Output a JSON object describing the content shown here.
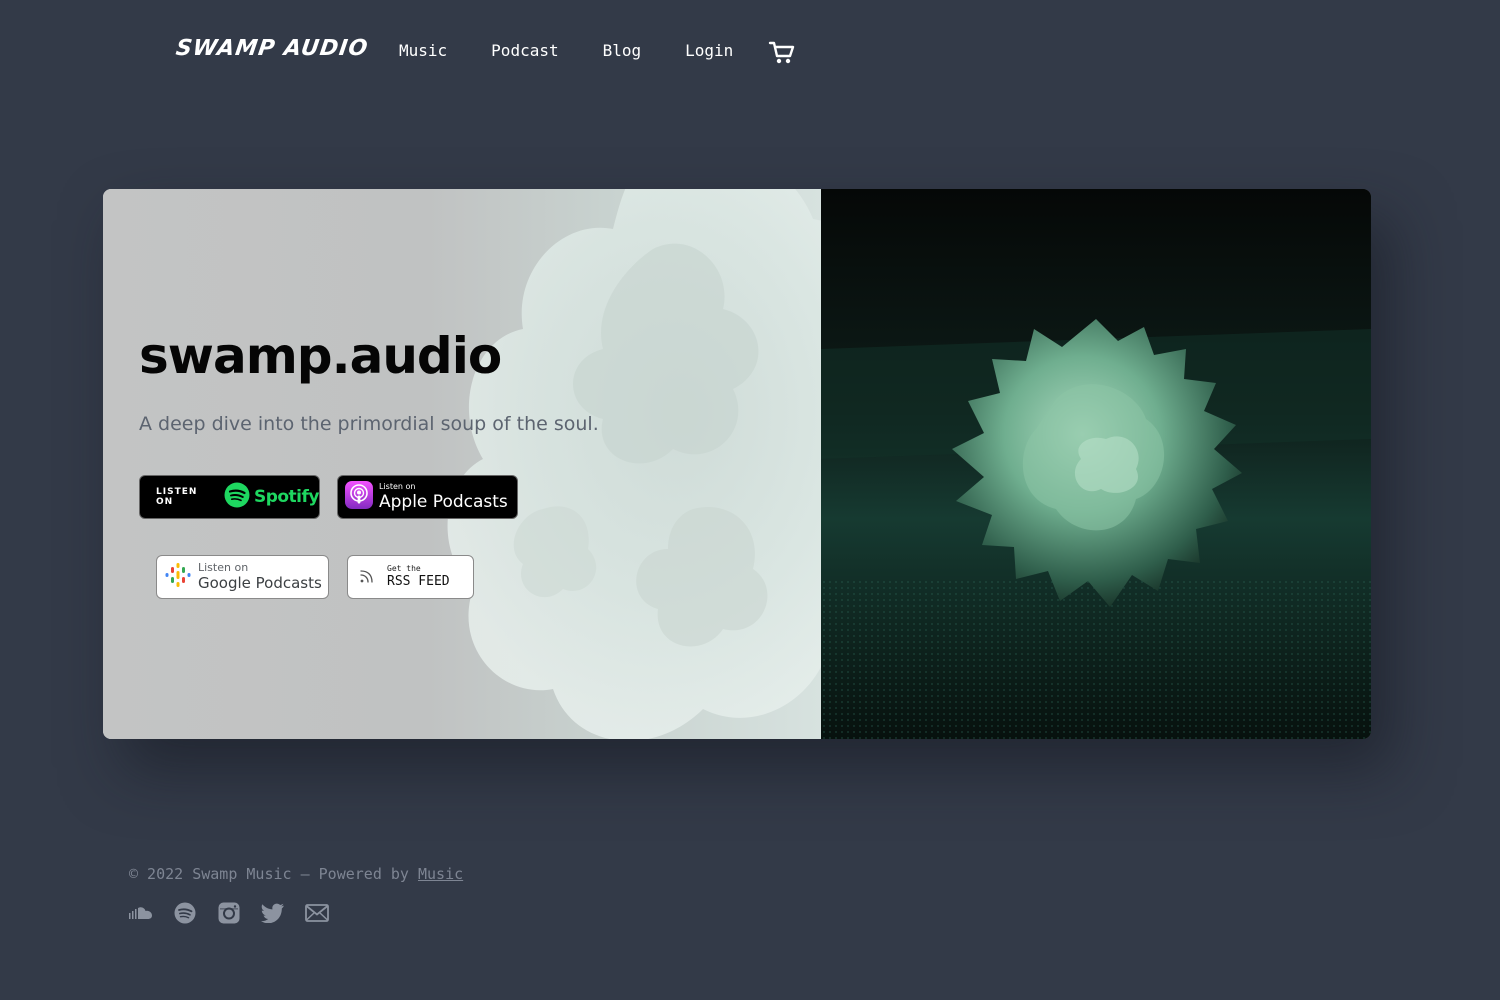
{
  "header": {
    "logo": "SWAMP AUDIO",
    "nav": [
      {
        "label": "Music"
      },
      {
        "label": "Podcast"
      },
      {
        "label": "Blog"
      },
      {
        "label": "Login"
      }
    ],
    "cart_icon": "cart-icon"
  },
  "hero": {
    "title": "swamp.audio",
    "subtitle": "A deep dive into the primordial soup of the soul.",
    "badges": {
      "spotify": {
        "pre": "LISTEN ON",
        "brand": "Spotify"
      },
      "apple": {
        "pre": "Listen on",
        "brand": "Apple Podcasts"
      },
      "google": {
        "pre": "Listen on",
        "brand": "Google Podcasts"
      },
      "rss": {
        "pre": "Get the",
        "brand": "RSS FEED"
      }
    },
    "image": "green-sphere-artwork"
  },
  "footer": {
    "copyright": "© 2022 Swamp Music — Powered by",
    "link": "Music",
    "social_icons": [
      "soundcloud-icon",
      "spotify-icon",
      "instagram-icon",
      "twitter-icon",
      "email-icon"
    ]
  },
  "colors": {
    "background": "#333a48",
    "spotify_green": "#1ed760",
    "footer_text": "#7e8593"
  }
}
